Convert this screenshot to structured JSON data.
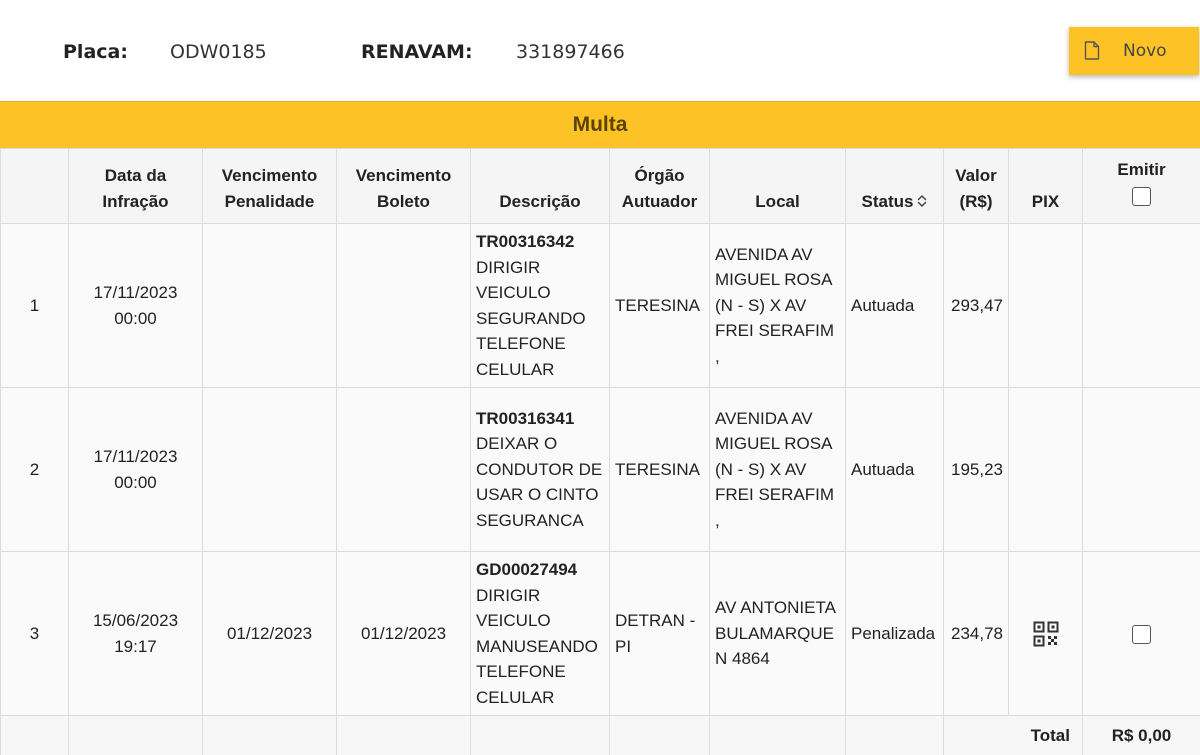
{
  "header": {
    "placa_label": "Placa:",
    "placa_value": "ODW0185",
    "renavam_label": "RENAVAM:",
    "renavam_value": "331897466",
    "novo_label": "Novo"
  },
  "section": {
    "title": "Multa"
  },
  "table": {
    "columns": {
      "data_infracao": [
        "Data da",
        "Infração"
      ],
      "venc_penalidade": [
        "Vencimento",
        "Penalidade"
      ],
      "venc_boleto": [
        "Vencimento",
        "Boleto"
      ],
      "descricao": "Descrição",
      "orgao": [
        "Órgão",
        "Autuador"
      ],
      "local": "Local",
      "status": "Status",
      "valor": [
        "Valor",
        "(R$)"
      ],
      "pix": "PIX",
      "emitir": "Emitir"
    },
    "rows": [
      {
        "index": "1",
        "data": [
          "17/11/2023",
          "00:00"
        ],
        "venc_penalidade": "",
        "venc_boleto": "",
        "codigo": "TR00316342",
        "descricao": "DIRIGIR VEICULO SEGURANDO TELEFONE CELULAR",
        "orgao": "TERESINA",
        "local": "AVENIDA AV MIGUEL ROSA (N - S) X AV FREI SERAFIM ,",
        "status": "Autuada",
        "valor": "293,47"
      },
      {
        "index": "2",
        "data": [
          "17/11/2023",
          "00:00"
        ],
        "venc_penalidade": "",
        "venc_boleto": "",
        "codigo": "TR00316341",
        "descricao": "DEIXAR O CONDUTOR DE USAR O CINTO SEGURANCA",
        "orgao": "TERESINA",
        "local": "AVENIDA AV MIGUEL ROSA (N - S) X AV FREI SERAFIM ,",
        "status": "Autuada",
        "valor": "195,23"
      },
      {
        "index": "3",
        "data": [
          "15/06/2023",
          "19:17"
        ],
        "venc_penalidade": "01/12/2023",
        "venc_boleto": "01/12/2023",
        "codigo": "GD00027494",
        "descricao": "DIRIGIR VEICULO MANUSEANDO TELEFONE CELULAR",
        "orgao": "DETRAN - PI",
        "local": "AV ANTONIETA BULAMARQUE N 4864",
        "status": "Penalizada",
        "valor": "234,78"
      }
    ],
    "total_label": "Total",
    "total_value": "R$ 0,00"
  },
  "icons": {
    "novo": "document-icon",
    "sort": "sort-icon",
    "pix": "qr-code-icon"
  },
  "colors": {
    "accent": "#fdc326",
    "header_bg": "#f5f5f5",
    "row_bg": "#fafafa"
  }
}
